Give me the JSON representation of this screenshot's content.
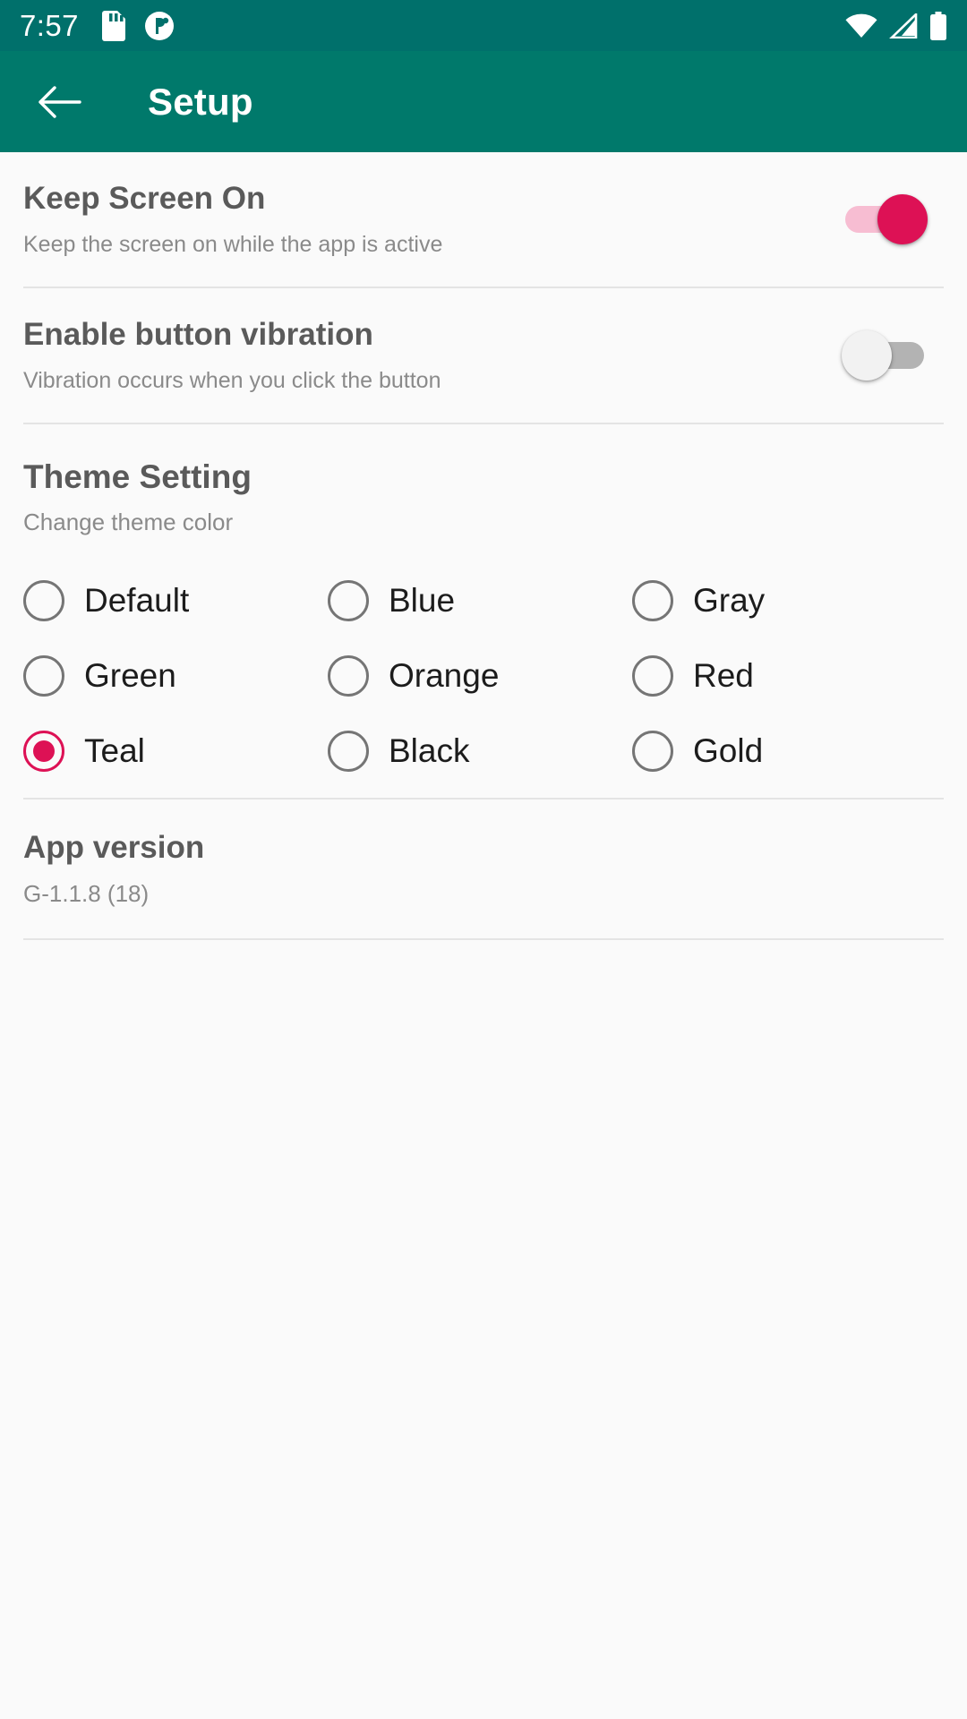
{
  "status_bar": {
    "time": "7:57",
    "icons_left": [
      "sd-card-icon",
      "app-notification-icon"
    ],
    "icons_right": [
      "wifi-icon",
      "cellular-signal-icon",
      "battery-icon"
    ],
    "background_color": "#00706B"
  },
  "app_bar": {
    "back_label": "back-arrow",
    "title": "Setup",
    "background_color": "#00796B"
  },
  "preferences": [
    {
      "title": "Keep Screen On",
      "subtitle": "Keep the screen on while the app is active",
      "switch_state": "on"
    },
    {
      "title": "Enable button vibration",
      "subtitle": "Vibration occurs when you click the button",
      "switch_state": "off"
    }
  ],
  "theme": {
    "title": "Theme Setting",
    "subtitle": "Change theme color",
    "selected": "Teal",
    "options": [
      "Default",
      "Blue",
      "Gray",
      "Green",
      "Orange",
      "Red",
      "Teal",
      "Black",
      "Gold"
    ]
  },
  "version": {
    "title": "App version",
    "value": "G-1.1.8 (18)"
  },
  "colors": {
    "accent": "#DD1155",
    "primary": "#00796B",
    "primary_dark": "#00706B"
  }
}
